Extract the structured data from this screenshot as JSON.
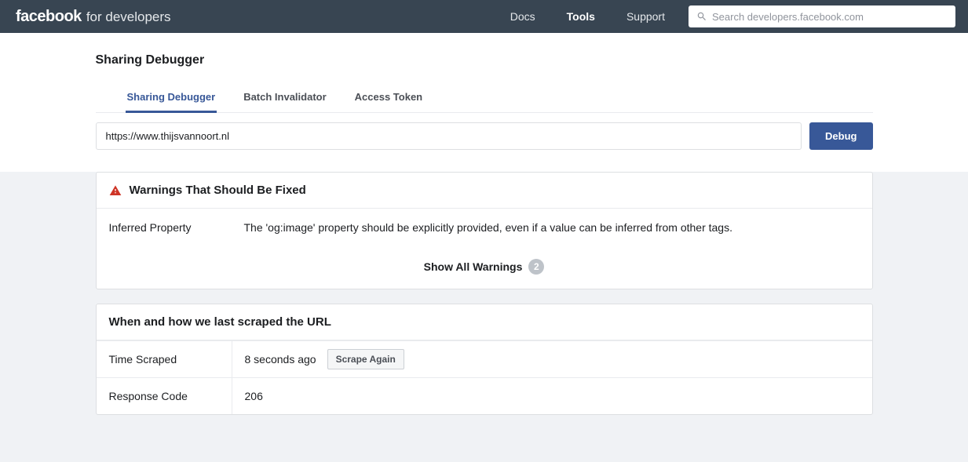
{
  "header": {
    "brand_bold": "facebook",
    "brand_light": "for developers",
    "nav": {
      "docs": "Docs",
      "tools": "Tools",
      "support": "Support"
    },
    "search_placeholder": "Search developers.facebook.com"
  },
  "page": {
    "title": "Sharing Debugger",
    "tabs": {
      "sharing": "Sharing Debugger",
      "batch": "Batch Invalidator",
      "token": "Access Token"
    },
    "url_value": "https://www.thijsvannoort.nl",
    "debug_label": "Debug"
  },
  "warnings": {
    "header": "Warnings That Should Be Fixed",
    "row_label": "Inferred Property",
    "row_value": "The 'og:image' property should be explicitly provided, even if a value can be inferred from other tags.",
    "show_all": "Show All Warnings",
    "count": "2"
  },
  "scrape": {
    "header": "When and how we last scraped the URL",
    "time_label": "Time Scraped",
    "time_value": "8 seconds ago",
    "scrape_again": "Scrape Again",
    "code_label": "Response Code",
    "code_value": "206"
  }
}
